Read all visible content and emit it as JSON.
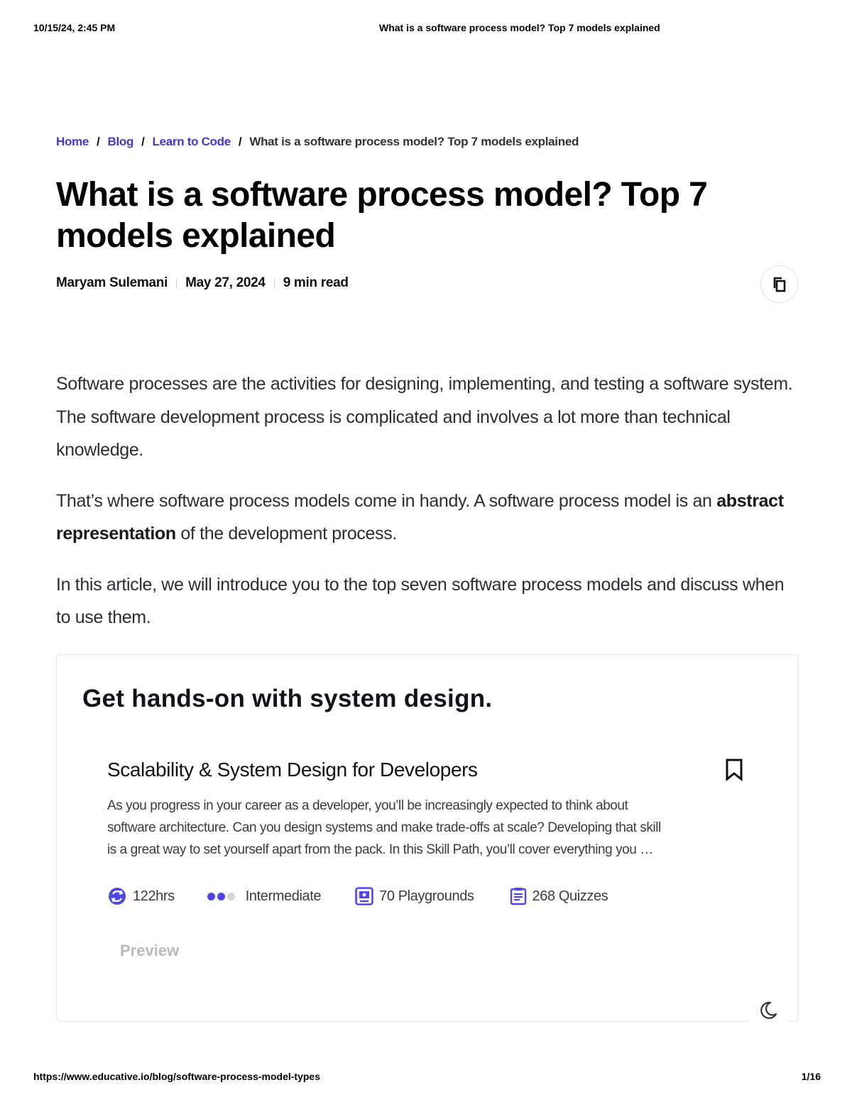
{
  "print_header": {
    "date": "10/15/24, 2:45 PM",
    "title": "What is a software process model? Top 7 models explained"
  },
  "breadcrumb": {
    "items": [
      "Home",
      "Blog",
      "Learn to Code"
    ],
    "separator": "/",
    "current": "What is a software process model? Top 7 models explained"
  },
  "article": {
    "title": "What is a software process model? Top 7 models explained",
    "author": "Maryam Sulemani",
    "date": "May 27, 2024",
    "read_time": "9 min read",
    "paragraphs": {
      "p1": "Software processes are the activities for designing, implementing, and testing a software system. The software development process is complicated and involves a lot more than technical knowledge.",
      "p2_before": "That’s where software process models come in handy. A software process model is an ",
      "p2_bold": "abstract representation",
      "p2_after": " of the development process.",
      "p3": "In this article, we will introduce you to the top seven software process models and discuss when to use them."
    }
  },
  "cta": {
    "heading": "Get hands-on with system design.",
    "course": {
      "title": "Scalability & System Design for Developers",
      "description_lines": [
        "As you progress in your career as a developer, you’ll be increasingly expected to think about",
        "software architecture. Can you design systems and make trade-offs at scale? Developing that skill",
        "is a great way to set yourself apart from the pack. In this Skill Path, you’ll cover everything you …"
      ],
      "duration": "122hrs",
      "level": "Intermediate",
      "playgrounds": "70 Playgrounds",
      "quizzes": "268 Quizzes",
      "preview_label": "Preview"
    }
  },
  "icons": {
    "copy": "copy-icon",
    "bookmark": "bookmark-icon",
    "clock": "clock-icon",
    "playground": "playground-icon",
    "quiz": "quiz-icon",
    "moon": "moon-icon"
  },
  "colors": {
    "link": "#4338ca",
    "accent": "#5046e5",
    "level_inactive": "#d4d4dc"
  },
  "print_footer": {
    "url": "https://www.educative.io/blog/software-process-model-types",
    "page": "1/16"
  }
}
